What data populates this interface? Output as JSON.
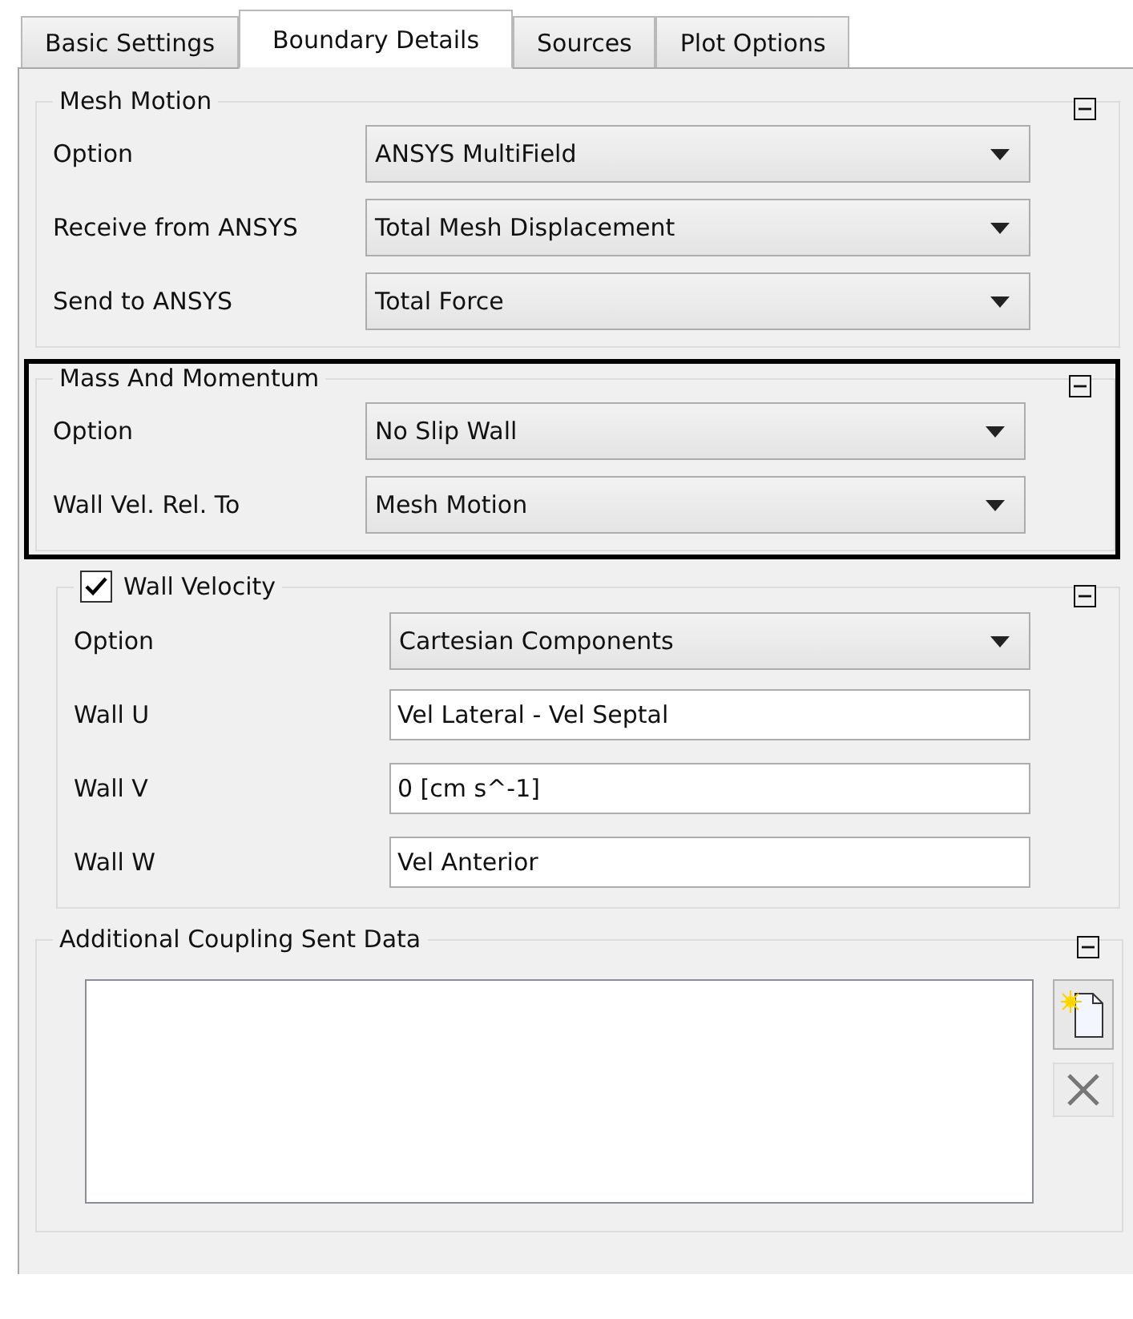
{
  "tabs": [
    {
      "label": "Basic Settings",
      "selected": false
    },
    {
      "label": "Boundary Details",
      "selected": true
    },
    {
      "label": "Sources",
      "selected": false
    },
    {
      "label": "Plot Options",
      "selected": false
    }
  ],
  "sections": [
    {
      "kind": "form",
      "title": "Mesh Motion",
      "highlighted": false,
      "expanded": true,
      "rows": [
        {
          "kind": "combo",
          "label": "Option",
          "value": "ANSYS MultiField"
        },
        {
          "kind": "combo",
          "label": "Receive from ANSYS",
          "value": "Total Mesh Displacement"
        },
        {
          "kind": "combo",
          "label": "Send to ANSYS",
          "value": "Total Force"
        }
      ]
    },
    {
      "kind": "form",
      "title": "Mass And Momentum",
      "highlighted": true,
      "expanded": true,
      "rows": [
        {
          "kind": "combo",
          "label": "Option",
          "value": "No Slip Wall"
        },
        {
          "kind": "combo",
          "label": "Wall Vel. Rel. To",
          "value": "Mesh Motion"
        }
      ]
    },
    {
      "kind": "checkform",
      "title": "Wall Velocity",
      "checked": true,
      "highlighted": false,
      "expanded": true,
      "rows": [
        {
          "kind": "combo",
          "label": "Option",
          "value": "Cartesian Components"
        },
        {
          "kind": "text",
          "label": "Wall U",
          "value": "Vel Lateral - Vel Septal"
        },
        {
          "kind": "text",
          "label": "Wall V",
          "value": "0 [cm s^-1]"
        },
        {
          "kind": "text",
          "label": "Wall W",
          "value": "Vel Anterior"
        }
      ]
    },
    {
      "kind": "list",
      "title": "Additional Coupling Sent Data",
      "highlighted": false,
      "expanded": true
    }
  ]
}
